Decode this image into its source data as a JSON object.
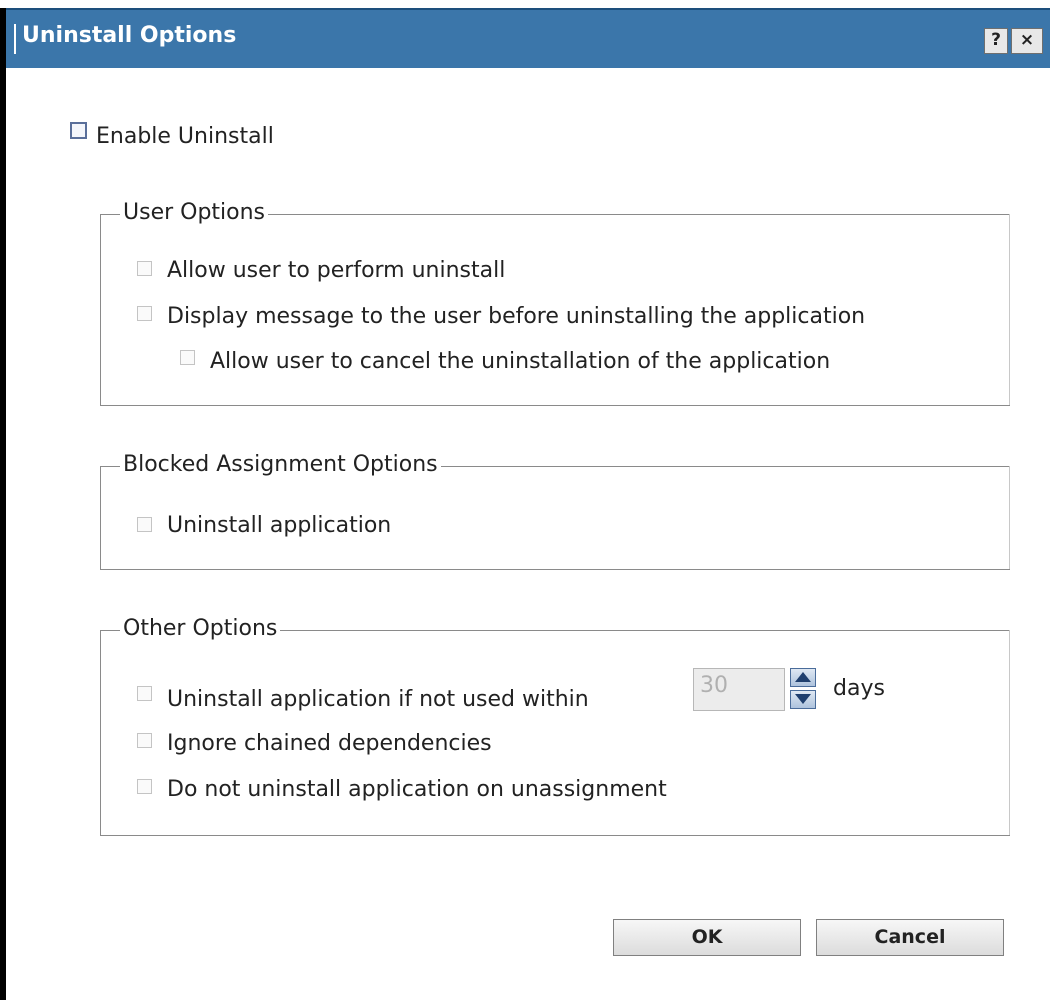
{
  "dialog": {
    "title": "Uninstall Options",
    "help_label": "?",
    "close_label": "×"
  },
  "enable_uninstall": {
    "label": "Enable Uninstall",
    "checked": false
  },
  "user_options": {
    "legend": "User Options",
    "allow_user": "Allow user to perform uninstall",
    "display_message": "Display message to the user before uninstalling the application",
    "allow_cancel": "Allow user to cancel the uninstallation of the application"
  },
  "blocked_options": {
    "legend": "Blocked Assignment Options",
    "uninstall_app": "Uninstall application"
  },
  "other_options": {
    "legend": "Other Options",
    "not_used_within": "Uninstall application if not used within",
    "days_value": "30",
    "days_unit": "days",
    "ignore_chained": "Ignore chained dependencies",
    "no_uninstall_unassign": "Do not uninstall application on unassignment"
  },
  "buttons": {
    "ok": "OK",
    "cancel": "Cancel"
  },
  "colors": {
    "titlebar": "#3b76aa",
    "text": "#222222"
  }
}
